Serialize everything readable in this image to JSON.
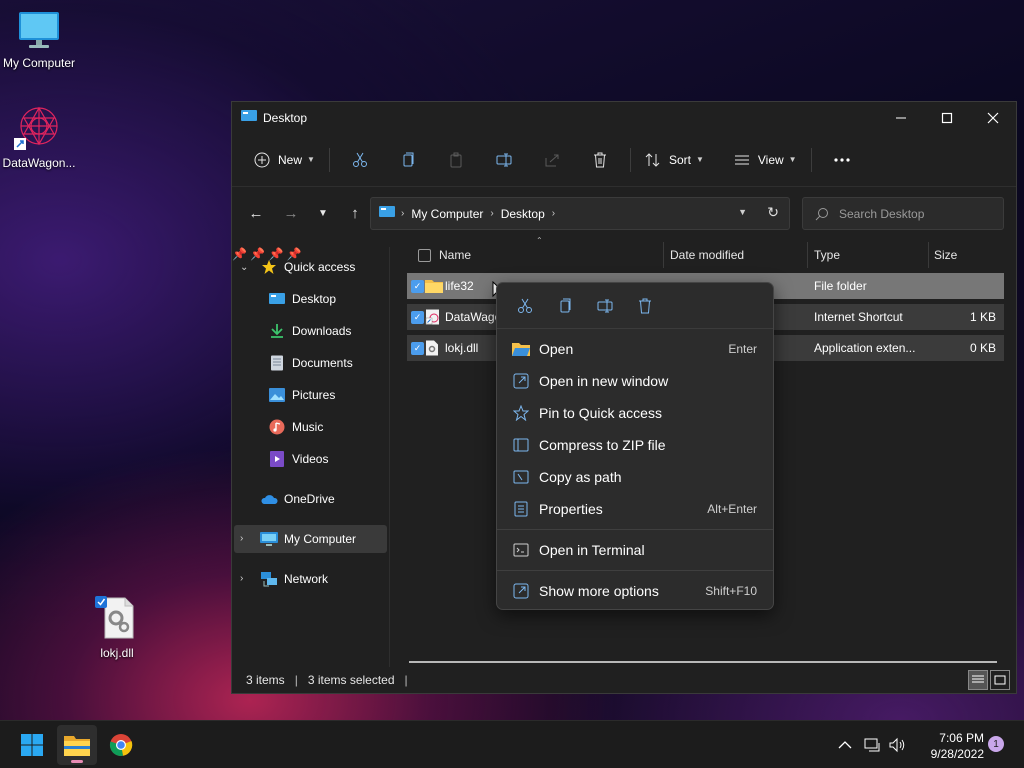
{
  "desktop": {
    "icons": [
      {
        "label": "My Computer",
        "icon": "monitor-icon"
      },
      {
        "label": "DataWagon...",
        "icon": "datawagon-shortcut-icon"
      },
      {
        "label": "lokj.dll",
        "icon": "dll-file-icon"
      }
    ]
  },
  "window": {
    "title": "Desktop",
    "controls": {
      "minimize": "minimize-icon",
      "maximize": "maximize-icon",
      "close": "close-icon"
    }
  },
  "toolbar": {
    "new_label": "New",
    "sort_label": "Sort",
    "view_label": "View",
    "icons": [
      "new-icon",
      "cut-icon",
      "copy-icon",
      "paste-icon",
      "rename-icon",
      "share-icon",
      "delete-icon",
      "more-icon"
    ]
  },
  "address": {
    "crumbs": [
      "My Computer",
      "Desktop"
    ],
    "search_placeholder": "Search Desktop"
  },
  "sidebar": {
    "quick_access": "Quick access",
    "items": [
      {
        "label": "Desktop",
        "pinned": true
      },
      {
        "label": "Downloads",
        "pinned": true
      },
      {
        "label": "Documents",
        "pinned": true
      },
      {
        "label": "Pictures",
        "pinned": true
      },
      {
        "label": "Music",
        "pinned": false
      },
      {
        "label": "Videos",
        "pinned": false
      }
    ],
    "onedrive": "OneDrive",
    "my_computer": "My Computer",
    "network": "Network"
  },
  "filelist": {
    "columns": {
      "name": "Name",
      "date": "Date modified",
      "type": "Type",
      "size": "Size"
    },
    "rows": [
      {
        "name": "life32",
        "date": "",
        "type": "File folder",
        "size": "",
        "selected": true
      },
      {
        "name": "DataWago",
        "date": "",
        "type": "Internet Shortcut",
        "size": "1 KB",
        "selected": true
      },
      {
        "name": "lokj.dll",
        "date": "",
        "type": "Application exten...",
        "size": "0 KB",
        "selected": true
      }
    ]
  },
  "status": {
    "items_count": "3 items",
    "selected_count": "3 items selected"
  },
  "context_menu": {
    "top_icons": [
      "cut-icon",
      "copy-icon",
      "rename-icon",
      "delete-icon"
    ],
    "items": [
      {
        "label": "Open",
        "accel": "Enter",
        "icon": "folder-icon"
      },
      {
        "label": "Open in new window",
        "accel": "",
        "icon": "new-window-icon"
      },
      {
        "label": "Pin to Quick access",
        "accel": "",
        "icon": "star-icon"
      },
      {
        "label": "Compress to ZIP file",
        "accel": "",
        "icon": "zip-icon"
      },
      {
        "label": "Copy as path",
        "accel": "",
        "icon": "path-icon"
      },
      {
        "label": "Properties",
        "accel": "Alt+Enter",
        "icon": "properties-icon"
      },
      {
        "label": "Open in Terminal",
        "accel": "",
        "icon": "terminal-icon"
      },
      {
        "label": "Show more options",
        "accel": "Shift+F10",
        "icon": "more-options-icon"
      }
    ]
  },
  "taskbar": {
    "time": "7:06 PM",
    "date": "9/28/2022",
    "notifications": "1",
    "apps": [
      "start-icon",
      "file-explorer-icon",
      "chrome-icon"
    ]
  },
  "colors": {
    "accent": "#4c9ded",
    "window_bg": "#202020",
    "menu_bg": "#2c2c2c",
    "selected_row": "#777777"
  }
}
